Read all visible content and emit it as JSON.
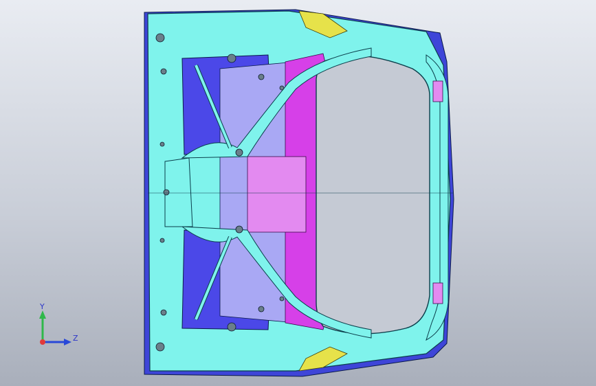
{
  "viewport": {
    "background_top": "#e9ecf2",
    "background_bottom": "#a9afbb"
  },
  "model": {
    "colors": {
      "frame": "#7ff3ec",
      "frame_edge": "#0a3d4a",
      "outer_panel": "#3e45d8",
      "inner_blue": "#4b48e8",
      "light_blue": "#a9a8f4",
      "magenta": "#d640e8",
      "hinge": "#e6e24a"
    }
  },
  "triad": {
    "y_label": "Y",
    "z_label": "Z",
    "y_color": "#2fb84a",
    "z_color": "#2848d8",
    "x_color": "#e23a3a"
  }
}
